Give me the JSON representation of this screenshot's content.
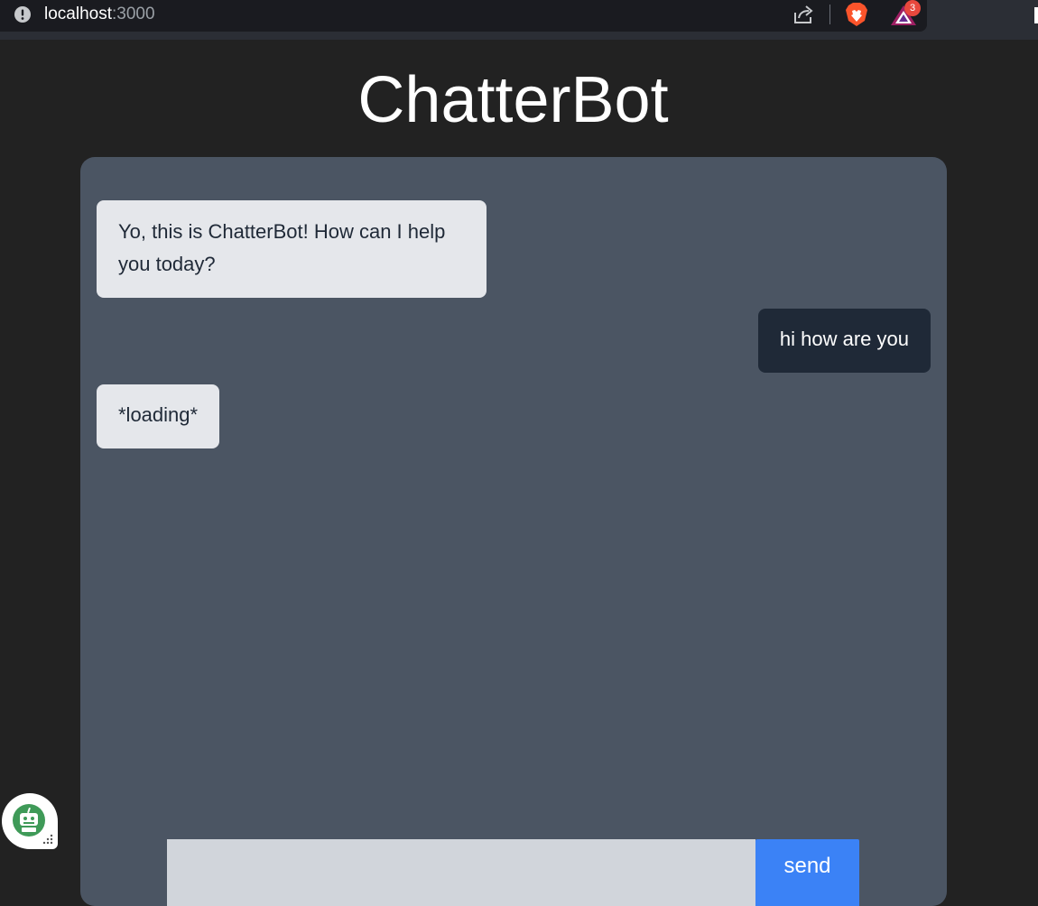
{
  "browser": {
    "url_host": "localhost",
    "url_port": ":3000",
    "rewards_badge_count": "3"
  },
  "app": {
    "title": "ChatterBot"
  },
  "messages": [
    {
      "role": "bot",
      "text": "Yo, this is ChatterBot! How can I help you today?"
    },
    {
      "role": "user",
      "text": "hi how are you"
    },
    {
      "role": "bot",
      "text": "*loading*"
    }
  ],
  "composer": {
    "input_value": "",
    "send_label": "send"
  },
  "colors": {
    "page_bg": "#222222",
    "panel_bg": "#4b5563",
    "bot_bubble": "#e5e7eb",
    "user_bubble": "#1f2937",
    "send_button": "#3b82f6",
    "input_bg": "#d1d5db"
  },
  "icons": {
    "info": "info-icon",
    "share": "share-icon",
    "brave": "brave-shields-icon",
    "rewards": "brave-rewards-icon",
    "widget": "robot-assistant-icon"
  }
}
